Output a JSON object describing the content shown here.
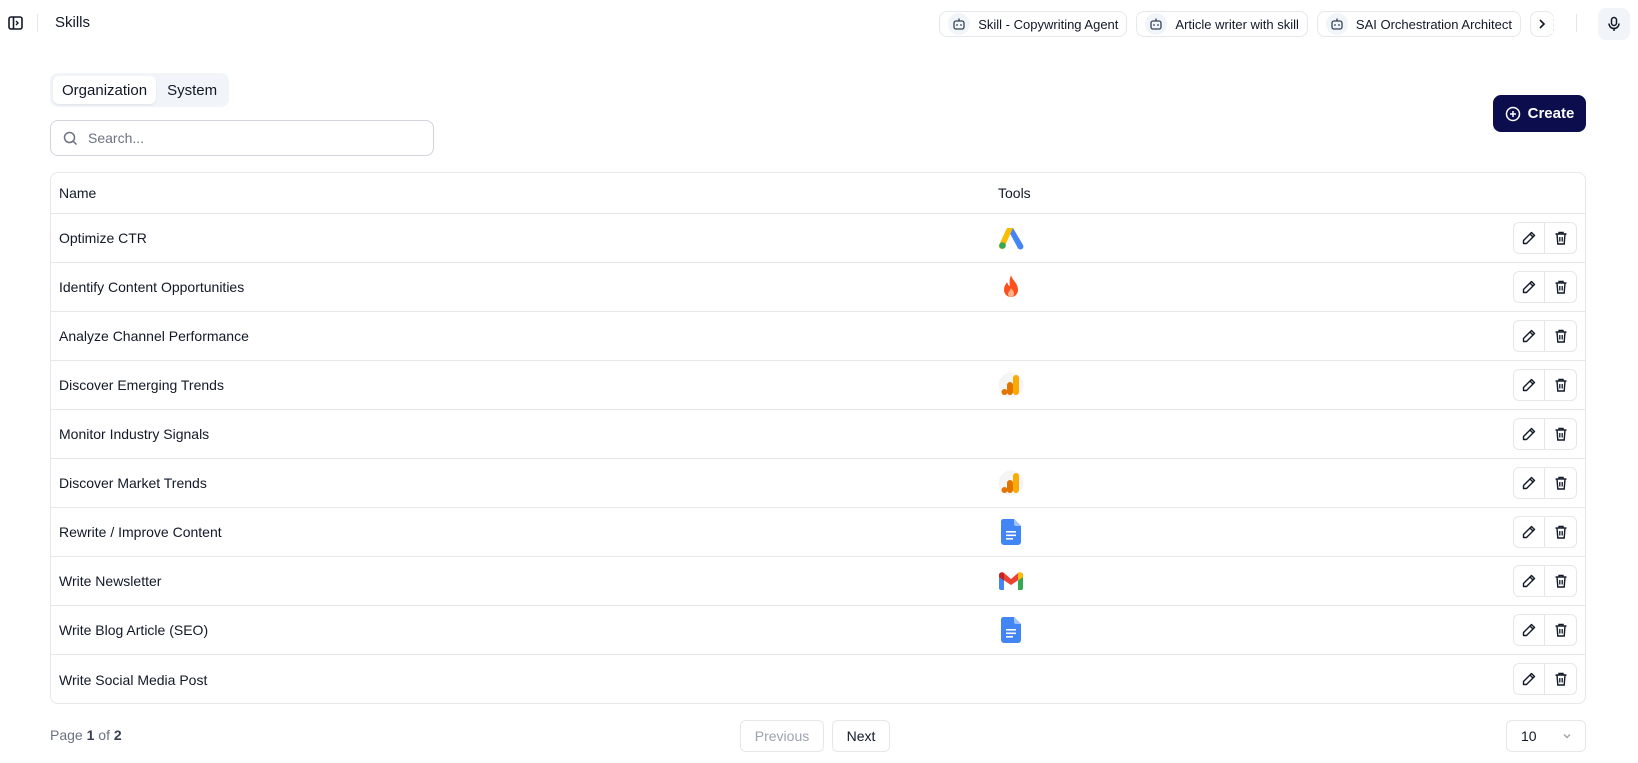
{
  "header": {
    "title": "Skills",
    "chips": [
      {
        "label": "Skill - Copywriting Agent"
      },
      {
        "label": "Article writer with skill"
      },
      {
        "label": "SAI Orchestration Architect"
      }
    ]
  },
  "tabs": [
    {
      "label": "Organization",
      "active": true
    },
    {
      "label": "System",
      "active": false
    }
  ],
  "search": {
    "placeholder": "Search..."
  },
  "create_label": "Create",
  "table": {
    "columns": {
      "name": "Name",
      "tools": "Tools"
    },
    "rows": [
      {
        "name": "Optimize CTR",
        "tool": "google-ads-icon"
      },
      {
        "name": "Identify Content Opportunities",
        "tool": "firecrawl-icon"
      },
      {
        "name": "Analyze Channel Performance",
        "tool": ""
      },
      {
        "name": "Discover Emerging Trends",
        "tool": "google-analytics-icon"
      },
      {
        "name": "Monitor Industry Signals",
        "tool": ""
      },
      {
        "name": "Discover Market Trends",
        "tool": "google-analytics-icon"
      },
      {
        "name": "Rewrite / Improve Content",
        "tool": "google-docs-icon"
      },
      {
        "name": "Write Newsletter",
        "tool": "gmail-icon"
      },
      {
        "name": "Write Blog Article (SEO)",
        "tool": "google-docs-icon"
      },
      {
        "name": "Write Social Media Post",
        "tool": ""
      }
    ]
  },
  "pagination": {
    "page_word": "Page",
    "current": "1",
    "of_word": "of",
    "total": "2",
    "previous": "Previous",
    "next": "Next",
    "page_size": "10"
  },
  "colors": {
    "primary": "#0b0d4d",
    "border": "#e5e7eb"
  }
}
